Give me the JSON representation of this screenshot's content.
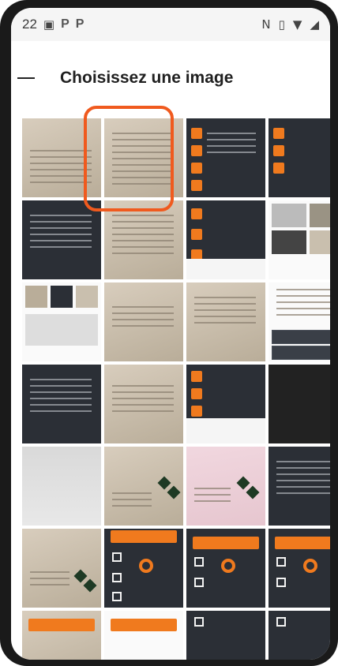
{
  "status": {
    "time": "22",
    "left_icons": [
      "image-icon",
      "p-icon",
      "p-icon"
    ],
    "right_icons": [
      "nfc-icon",
      "vibrate-icon",
      "wifi-icon",
      "signal-icon"
    ]
  },
  "header": {
    "title": "Choisissez une image",
    "back_icon": "back-arrow-icon"
  },
  "grid": {
    "columns": 4,
    "thumbnails": [
      "business-card-photo",
      "business-card-photo-selected",
      "app-screenshot-dark",
      "app-screenshot-dark",
      "app-screenshot-dark",
      "business-card-photo",
      "app-screenshot-dark",
      "app-screenshot-collage",
      "app-screenshot-collage",
      "business-card-photo",
      "business-card-photo",
      "app-screenshot-white",
      "app-screenshot-dark",
      "business-card-photo",
      "app-screenshot-dark",
      "blank-dark",
      "blank-gray",
      "business-card-photo",
      "pink-card-photo",
      "app-screenshot-dark",
      "app-screenshot-dark",
      "app-screenshot-dark",
      "app-screenshot-white",
      "app-screenshot-white",
      "business-card-photo",
      "app-screenshot-orange",
      "app-screenshot-orange",
      "app-screenshot-white"
    ],
    "selected_index": 1,
    "accent": "#f05a1e"
  }
}
